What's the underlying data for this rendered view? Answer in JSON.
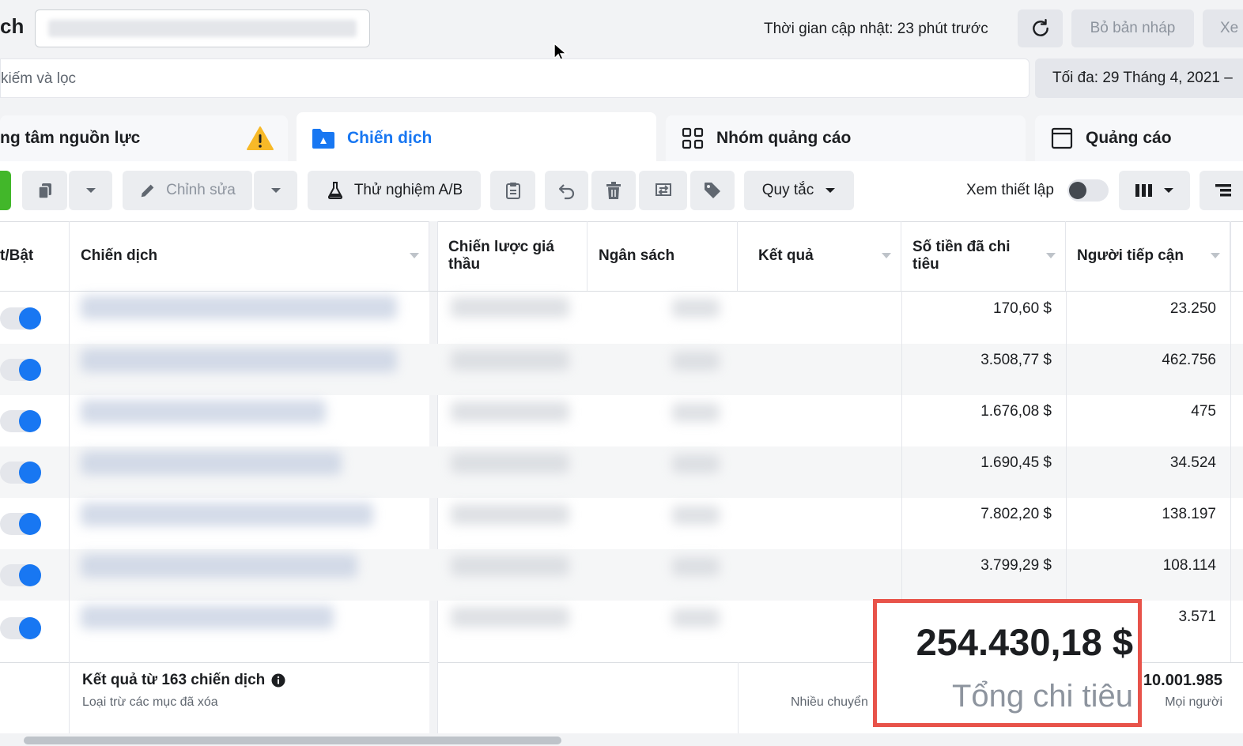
{
  "header": {
    "title_fragment": "ch",
    "update_text": "Thời gian cập nhật: 23 phút trước",
    "discard_label": "Bỏ bản nháp",
    "review_label": "Xe"
  },
  "search": {
    "placeholder": "kiếm và lọc",
    "date_range": "Tối đa: 29 Tháng 4, 2021 –"
  },
  "tabs": [
    {
      "label": "ng tâm nguồn lực"
    },
    {
      "label": "Chiến dịch"
    },
    {
      "label": "Nhóm quảng cáo"
    },
    {
      "label": "Quảng cáo"
    }
  ],
  "toolbar": {
    "edit_label": "Chỉnh sửa",
    "ab_test_label": "Thử nghiệm A/B",
    "rules_label": "Quy tắc",
    "view_setup_label": "Xem thiết lập"
  },
  "table": {
    "columns": [
      "t/Bật",
      "Chiến dịch",
      "Chiến lược giá thầu",
      "Ngân sách",
      "Kết quả",
      "Số tiền đã chi tiêu",
      "Người tiếp cận"
    ],
    "rows": [
      {
        "spent": "170,60 $",
        "reach": "23.250"
      },
      {
        "spent": "3.508,77 $",
        "reach": "462.756"
      },
      {
        "spent": "1.676,08 $",
        "reach": "475"
      },
      {
        "spent": "1.690,45 $",
        "reach": "34.524"
      },
      {
        "spent": "7.802,20 $",
        "reach": "138.197"
      },
      {
        "spent": "3.799,29 $",
        "reach": "108.114"
      },
      {
        "spent": "",
        "reach": "3.571"
      }
    ]
  },
  "footer": {
    "summary_title": "Kết quả từ 163 chiến dịch",
    "summary_sub": "Loại trừ các mục đã xóa",
    "results_note": "Nhiều chuyển",
    "total_spent": "254.430,18 $",
    "total_spent_label": "Tổng chi tiêu",
    "total_reach": "10.001.985",
    "total_reach_label": "Mọi người"
  },
  "colors": {
    "accent": "#1877f2",
    "highlight": "#e8534a",
    "warning": "#f7b928"
  }
}
